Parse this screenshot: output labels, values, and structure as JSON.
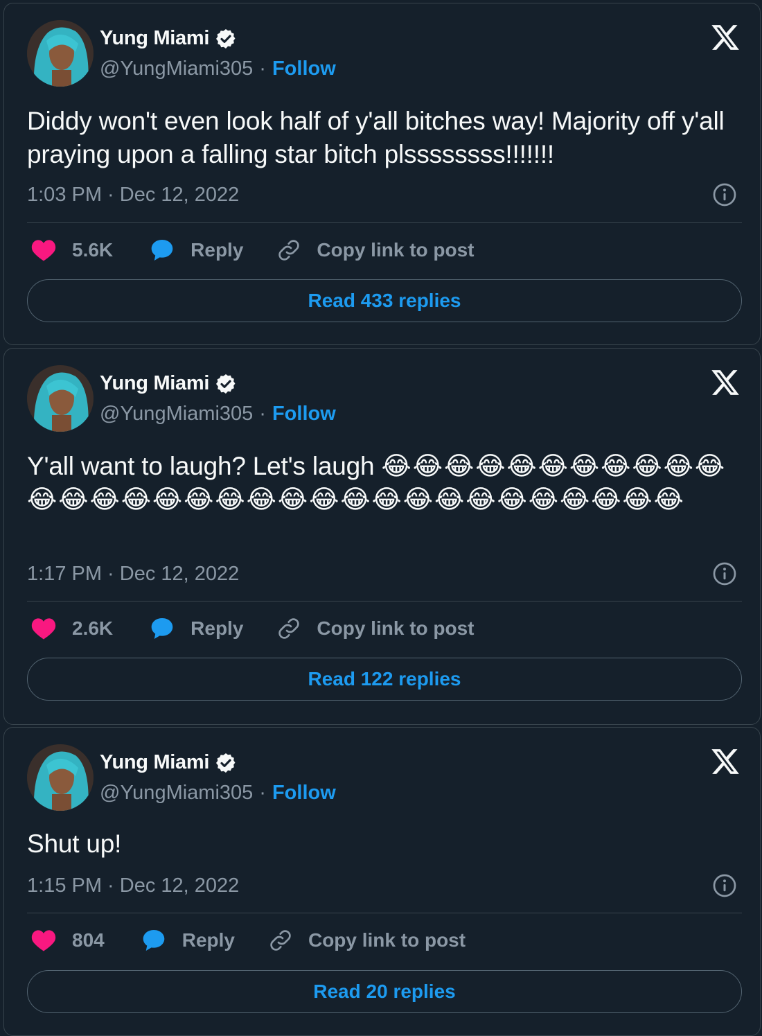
{
  "tweets": [
    {
      "author_name": "Yung Miami",
      "handle": "@YungMiami305",
      "separator": "·",
      "follow_label": "Follow",
      "text": "Diddy won't even look half of y'all bitches way! Majority off y'all praying upon a falling star bitch plssssssss!!!!!!!",
      "timestamp": "1:03 PM · Dec 12, 2022",
      "likes": "5.6K",
      "reply_label": "Reply",
      "copy_label": "Copy link to post",
      "read_replies_label": "Read 433 replies"
    },
    {
      "author_name": "Yung Miami",
      "handle": "@YungMiami305",
      "separator": "·",
      "follow_label": "Follow",
      "text": "Y'all want to laugh? Let's laugh ",
      "emojis": "😂😂😂😂😂😂😂😂😂😂😂😂😂😂😂😂😂😂😂😂😂😂😂😂😂😂😂😂😂😂😂😂",
      "timestamp": "1:17 PM · Dec 12, 2022",
      "likes": "2.6K",
      "reply_label": "Reply",
      "copy_label": "Copy link to post",
      "read_replies_label": "Read 122 replies"
    },
    {
      "author_name": "Yung Miami",
      "handle": "@YungMiami305",
      "separator": "·",
      "follow_label": "Follow",
      "text": "Shut up!",
      "timestamp": "1:15 PM · Dec 12, 2022",
      "likes": "804",
      "reply_label": "Reply",
      "copy_label": "Copy link to post",
      "read_replies_label": "Read 20 replies"
    }
  ],
  "icons": {
    "verified": "verified-badge-icon",
    "platform": "x-logo-icon",
    "info": "info-icon",
    "like": "heart-icon",
    "reply": "speech-bubble-icon",
    "copy": "link-icon"
  },
  "colors": {
    "background": "#15202b",
    "border": "#38444d",
    "text": "#f7f9f9",
    "muted": "#8b98a5",
    "accent": "#1d9bf0",
    "like": "#f91880"
  }
}
